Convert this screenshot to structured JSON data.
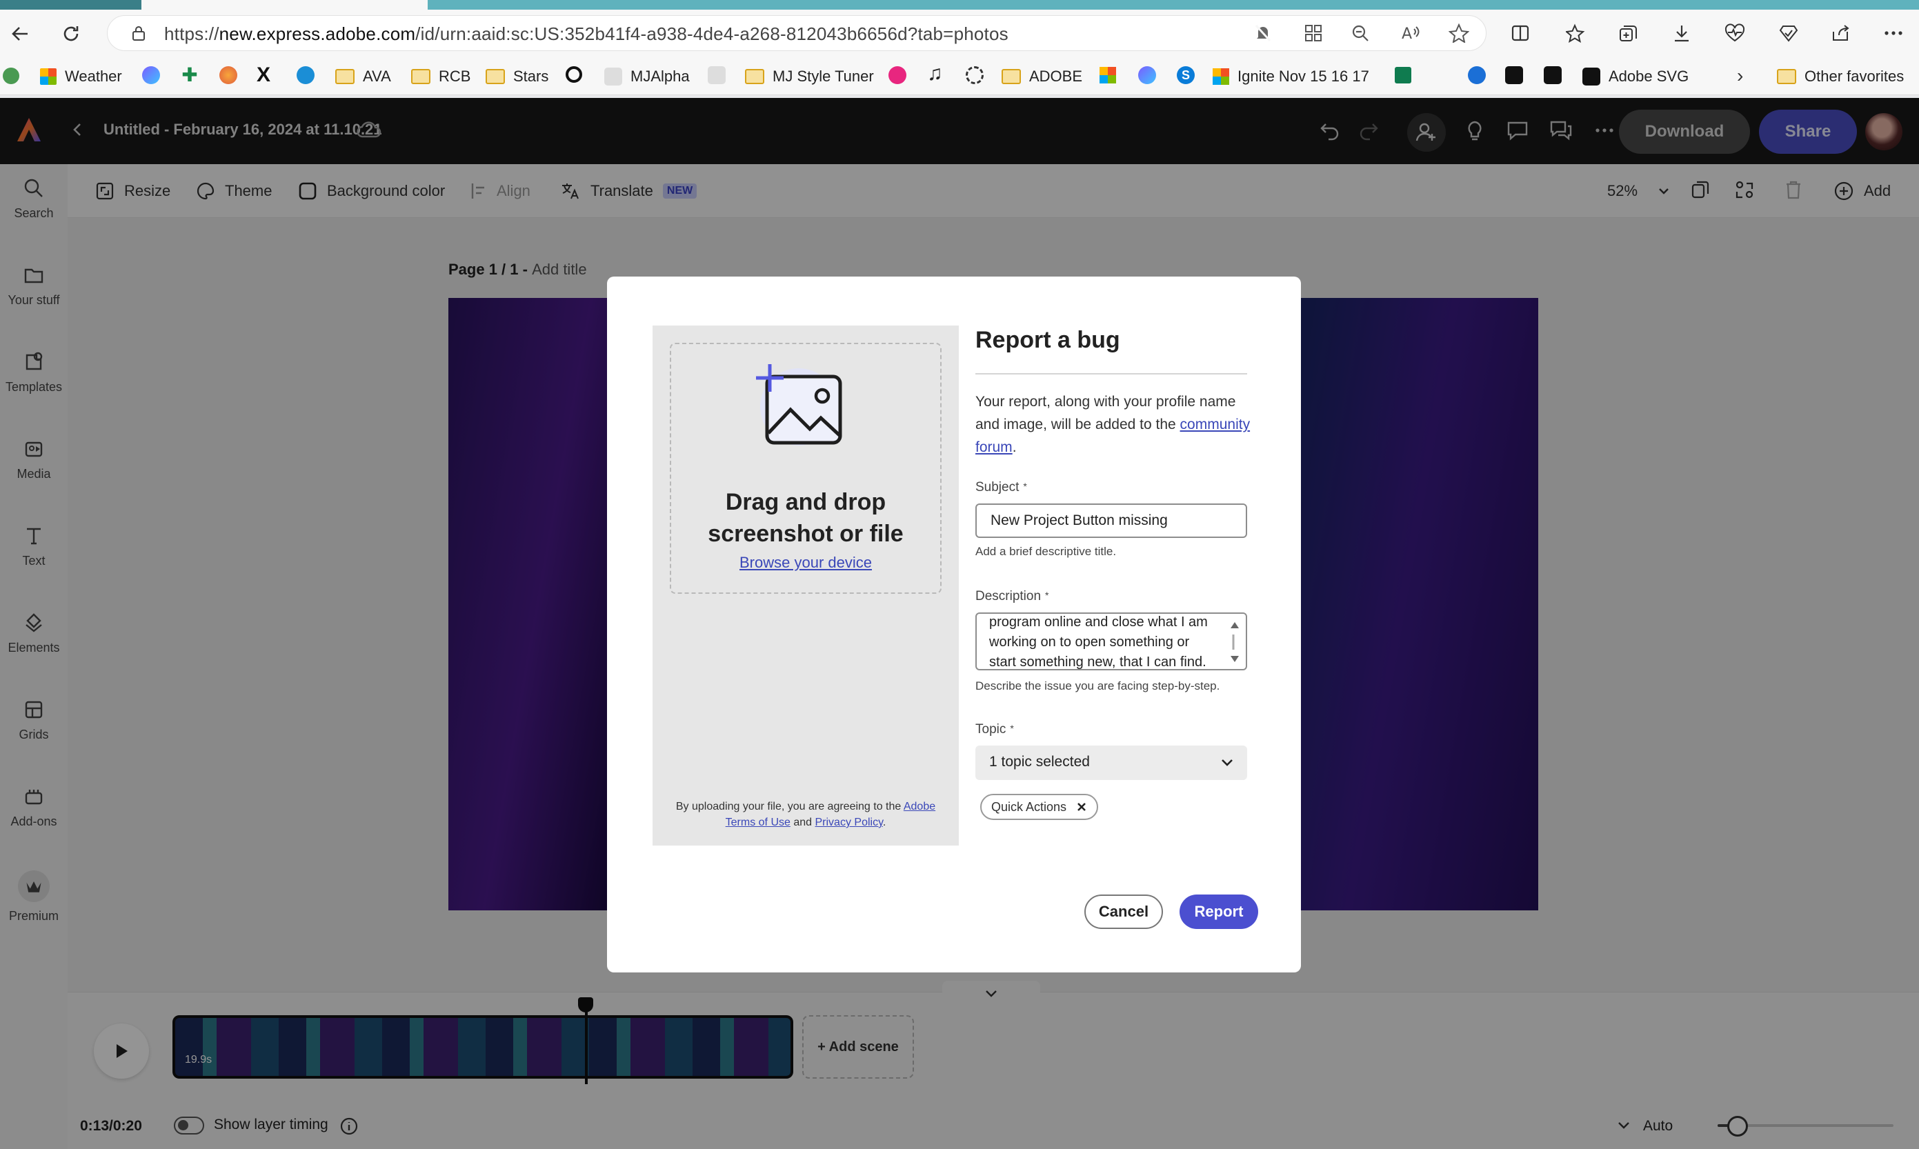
{
  "browser": {
    "url_prefix": "https://",
    "url_host": "new.express.adobe.com",
    "url_rest": "/id/urn:aaid:sc:US:352b41f4-a938-4de4-a268-812043b6656d?tab=photos",
    "bookmarks": [
      {
        "label": "Weather",
        "icon": "weather-icon"
      },
      {
        "label": "AVA",
        "icon": "folder-icon"
      },
      {
        "label": "RCB",
        "icon": "folder-icon"
      },
      {
        "label": "Stars",
        "icon": "folder-icon"
      },
      {
        "label": "MJAlpha",
        "icon": "mj-icon"
      },
      {
        "label": "MJ Style Tuner",
        "icon": "folder-icon"
      },
      {
        "label": "ADOBE",
        "icon": "folder-icon"
      },
      {
        "label": "Ignite Nov 15 16 17",
        "icon": "microsoft-icon"
      },
      {
        "label": "Adobe SVG",
        "icon": "adobe-icon"
      },
      {
        "label": "Other favorites",
        "icon": "folder-icon"
      }
    ]
  },
  "app": {
    "doc_title": "Untitled - February 16, 2024 at 11.10.21",
    "download_label": "Download",
    "share_label": "Share"
  },
  "sidebar": {
    "items": [
      {
        "label": "Search",
        "icon": "search-icon"
      },
      {
        "label": "Your stuff",
        "icon": "folder-icon"
      },
      {
        "label": "Templates",
        "icon": "templates-icon"
      },
      {
        "label": "Media",
        "icon": "media-icon"
      },
      {
        "label": "Text",
        "icon": "text-icon"
      },
      {
        "label": "Elements",
        "icon": "elements-icon"
      },
      {
        "label": "Grids",
        "icon": "grids-icon"
      },
      {
        "label": "Add-ons",
        "icon": "addons-icon"
      },
      {
        "label": "Premium",
        "icon": "premium-icon"
      }
    ]
  },
  "toolbar": {
    "resize": "Resize",
    "theme": "Theme",
    "background_color": "Background color",
    "align": "Align",
    "translate": "Translate",
    "new_badge": "NEW",
    "zoom": "52%",
    "add": "Add"
  },
  "canvas": {
    "page_label": "Page 1 / 1 - ",
    "add_title": "Add title"
  },
  "timeline": {
    "scene_duration": "19.9s",
    "add_scene": "+ Add scene",
    "time": "0:13/0:20",
    "show_layer_timing": "Show layer timing",
    "auto": "Auto"
  },
  "dialog": {
    "drop_title": "Drag and drop screenshot or file",
    "browse": "Browse your device",
    "terms_prefix": "By uploading your file, you are agreeing to the ",
    "terms_link1": "Adobe Terms of Use",
    "terms_and": " and ",
    "terms_link2": "Privacy Policy",
    "terms_suffix": ".",
    "title": "Report a bug",
    "intro": "Your report, along with your profile name and image, will be added to the ",
    "intro_link": "community forum",
    "intro_end": ".",
    "subject_label": "Subject",
    "subject_value": "New Project Button missing",
    "subject_help": "Add a brief descriptive title.",
    "description_label": "Description",
    "description_value": "program online and close what I am working on to open something or start something new, that I can find.",
    "description_help": "Describe the issue you are facing step-by-step.",
    "topic_label": "Topic",
    "topic_value": "1 topic selected",
    "topic_chip": "Quick Actions",
    "required_mark": "*",
    "cancel": "Cancel",
    "report": "Report"
  },
  "colors": {
    "accent": "#4b4fd0",
    "header_bg": "#191919",
    "link": "#3a47b8"
  }
}
